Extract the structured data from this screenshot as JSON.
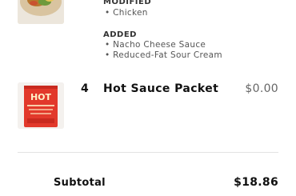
{
  "item1": {
    "image_name": "burrito-image",
    "modified_label": "MODIFIED",
    "modified": [
      "• Chicken"
    ],
    "added_label": "ADDED",
    "added": [
      "• Nacho Cheese Sauce",
      "• Reduced-Fat Sour Cream"
    ]
  },
  "item2": {
    "image_name": "hot-sauce-packet-image",
    "image_text": "HOT",
    "quantity": "4",
    "name": "Hot Sauce Packet",
    "price": "$0.00"
  },
  "summary": {
    "subtotal_label": "Subtotal",
    "subtotal_value": "$18.86"
  },
  "colors": {
    "packet_red": "#e2392b",
    "packet_text": "#fff2c8"
  }
}
